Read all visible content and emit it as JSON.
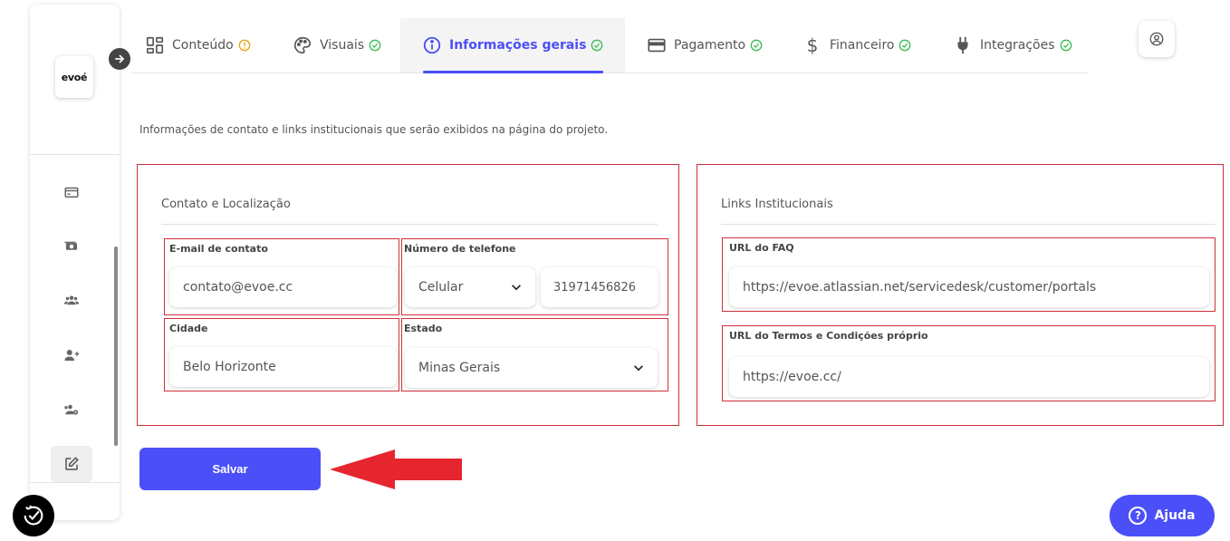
{
  "sidebar": {
    "logo_text": "evoé",
    "icons": [
      "credit-card-icon",
      "money-icon",
      "users-icon",
      "add-user-icon",
      "group-settings-icon",
      "edit-icon"
    ]
  },
  "tabs": [
    {
      "label": "Conteúdo",
      "icon": "grid-icon",
      "status": "warning"
    },
    {
      "label": "Visuais",
      "icon": "palette-icon",
      "status": "ok"
    },
    {
      "label": "Informações gerais",
      "icon": "info-icon",
      "status": "ok",
      "active": true
    },
    {
      "label": "Pagamento",
      "icon": "card-icon",
      "status": "ok"
    },
    {
      "label": "Financeiro",
      "icon": "dollar-icon",
      "status": "ok"
    },
    {
      "label": "Integrações",
      "icon": "plug-icon",
      "status": "ok"
    }
  ],
  "intro": "Informações de contato e links institucionais que serão exibidos na página do projeto.",
  "contact_panel": {
    "title": "Contato e Localização",
    "email_label": "E-mail de contato",
    "email_value": "contato@evoe.cc",
    "phone_label": "Número de telefone",
    "phone_type": "Celular",
    "phone_value": "31971456826",
    "city_label": "Cidade",
    "city_value": "Belo Horizonte",
    "state_label": "Estado",
    "state_value": "Minas Gerais"
  },
  "links_panel": {
    "title": "Links Institucionais",
    "faq_label": "URL do FAQ",
    "faq_value": "https://evoe.atlassian.net/servicedesk/customer/portals",
    "terms_label": "URL do Termos e Condições próprio",
    "terms_value": "https://evoe.cc/"
  },
  "save_label": "Salvar",
  "help_label": "Ajuda",
  "colors": {
    "primary": "#4b4ff7",
    "annotation_red": "#d0303a",
    "ok_green": "#3dbb57",
    "warning_orange": "#e8a317"
  }
}
